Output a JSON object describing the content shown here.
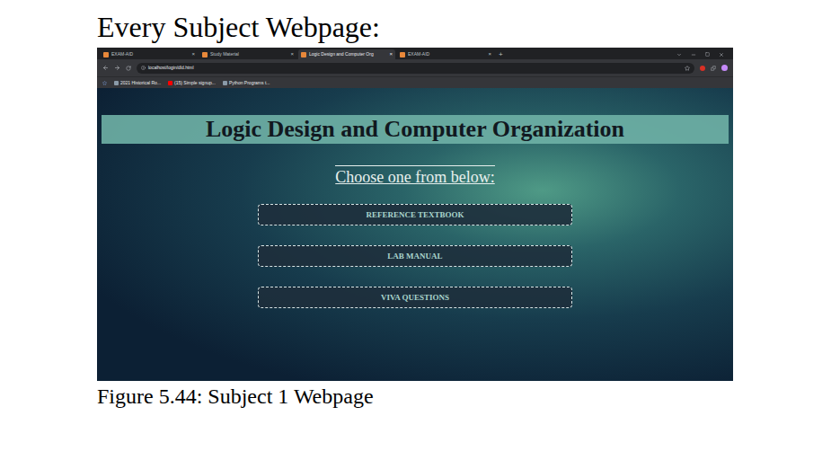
{
  "page": {
    "heading": "Every Subject Webpage:",
    "caption": "Figure 5.44: Subject 1 Webpage"
  },
  "browser": {
    "tabs": [
      {
        "label": "EXAM-AID",
        "selected": false
      },
      {
        "label": "Study Material",
        "selected": false
      },
      {
        "label": "Logic Design and Computer Org",
        "selected": true
      },
      {
        "label": "EXAM-AID",
        "selected": false
      }
    ],
    "tab_close": "×",
    "new_tab": "+",
    "address": "localhost/login/dld.html",
    "bookmarks": [
      "2021 Historical Ro...",
      "(15) Simple signup...",
      "Python Programs t..."
    ]
  },
  "site": {
    "title": "Logic Design and Computer Organization",
    "prompt": "Choose one from below:",
    "buttons": [
      "REFERENCE TEXTBOOK",
      "LAB MANUAL",
      "VIVA QUESTIONS"
    ]
  }
}
